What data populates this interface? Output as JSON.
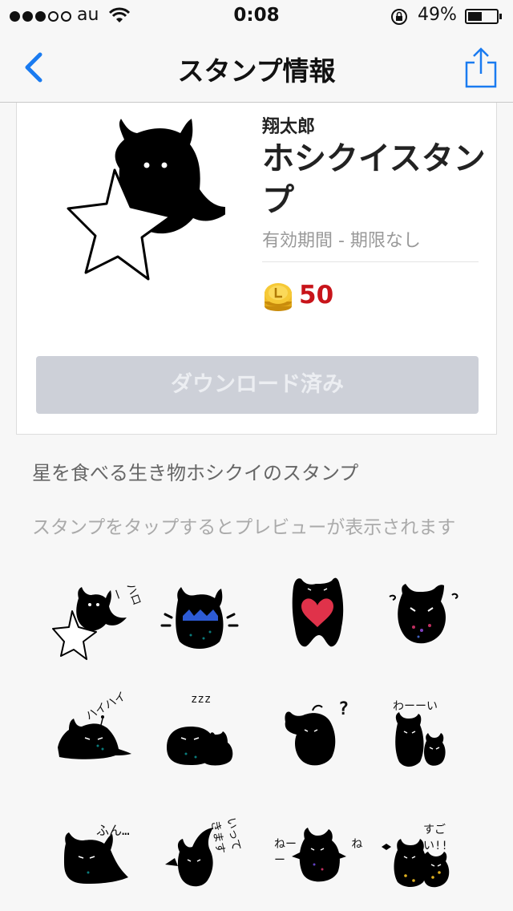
{
  "status_bar": {
    "carrier": "au",
    "time": "0:08",
    "battery_percent": "49%",
    "battery_level": 0.49,
    "signal_filled": 3,
    "signal_total": 5
  },
  "nav": {
    "title": "スタンプ情報",
    "back_icon": "chevron-left-icon",
    "share_icon": "share-icon"
  },
  "product": {
    "author": "翔太郎",
    "name": "ホシクイスタンプ",
    "validity": "有効期間 - 期限なし",
    "price": "50",
    "download_label": "ダウンロード済み"
  },
  "description": "星を食べる生き物ホシクイのスタンプ",
  "preview_hint": "スタンプをタップするとプレビューが表示されます",
  "stickers": [
    {
      "caption": "ハロー"
    },
    {
      "caption": ""
    },
    {
      "caption": ""
    },
    {
      "caption": ""
    },
    {
      "caption": "ハイハイ"
    },
    {
      "caption": "zzz"
    },
    {
      "caption": "?"
    },
    {
      "caption": "わーーい"
    },
    {
      "caption": "ふん…"
    },
    {
      "caption": "いってきます"
    },
    {
      "caption": "ねー ねー"
    },
    {
      "caption": "すごい!!"
    }
  ],
  "colors": {
    "accent": "#1a7bf0",
    "price": "#c8141a",
    "button_disabled": "#cdd0d8"
  }
}
